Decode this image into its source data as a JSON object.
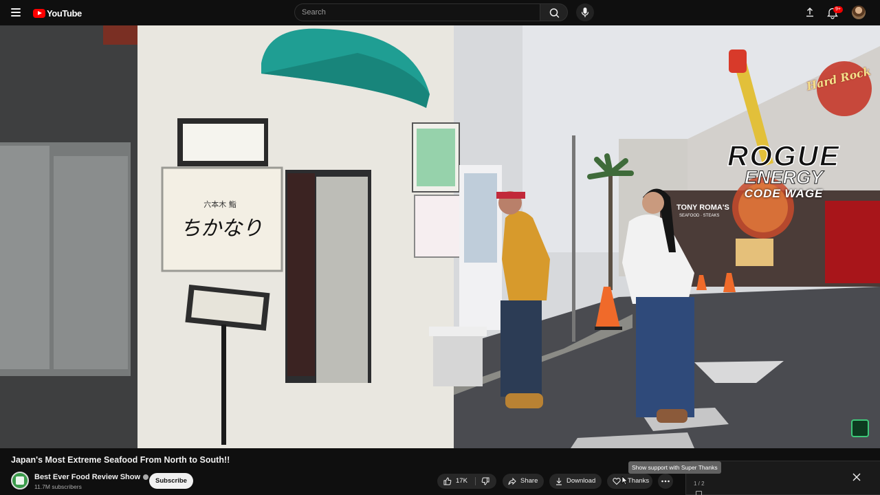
{
  "header": {
    "logo_text": "YouTube",
    "search_placeholder": "Search",
    "notifications_badge": "9+",
    "icons": [
      "menu-icon",
      "youtube-logo-icon",
      "search-icon",
      "mic-icon",
      "upload-icon",
      "bell-icon",
      "avatar"
    ]
  },
  "video": {
    "overlay_brand": "ROGUE",
    "overlay_brand_sub": "ENERGY",
    "overlay_code": "CODE WAGE",
    "scene_sign_hardrock": "Hard Rock",
    "scene_sign_restaurant": "TONY ROMA'S",
    "scene_sign_restaurant_sub": "SEAFOOD · STEAKS"
  },
  "details": {
    "title": "Japan's Most Extreme Seafood From North to South!!",
    "channel_name": "Best Ever Food Review Show",
    "subscribers": "11.7M subscribers",
    "subscribe_label": "Subscribe",
    "like_count": "17K",
    "share_label": "Share",
    "download_label": "Download",
    "thanks_label": "Thanks",
    "tooltip": "Show support with Super Thanks"
  },
  "side_panel": {
    "counter": "1 / 2"
  },
  "colors": {
    "background": "#0f0f0f",
    "pill": "#272727",
    "brand_red": "#ff0000",
    "badge_red": "#e00000"
  }
}
